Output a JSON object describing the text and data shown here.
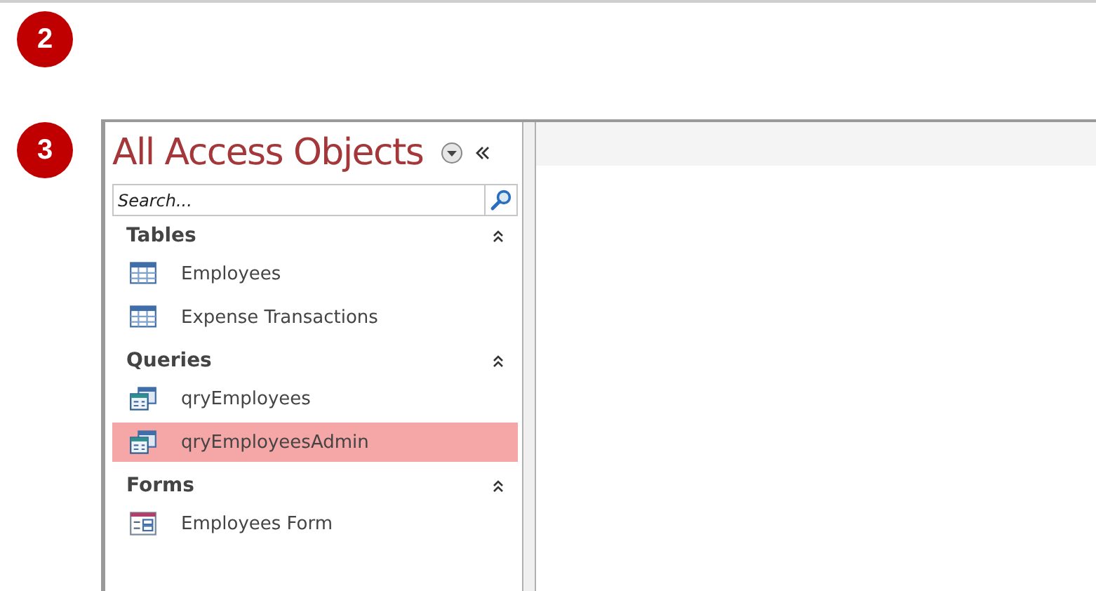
{
  "badges": [
    {
      "label": "2"
    },
    {
      "label": "3"
    }
  ],
  "navigation_pane": {
    "title": "All Access Objects",
    "search": {
      "placeholder": "Search..."
    },
    "groups": [
      {
        "label": "Tables",
        "expanded": true,
        "items": [
          {
            "label": "Employees",
            "kind": "table",
            "selected": false
          },
          {
            "label": "Expense Transactions",
            "kind": "table",
            "selected": false
          }
        ]
      },
      {
        "label": "Queries",
        "expanded": true,
        "items": [
          {
            "label": "qryEmployees",
            "kind": "query",
            "selected": false
          },
          {
            "label": "qryEmployeesAdmin",
            "kind": "query",
            "selected": true
          }
        ]
      },
      {
        "label": "Forms",
        "expanded": true,
        "items": [
          {
            "label": "Employees Form",
            "kind": "form",
            "selected": false
          }
        ]
      }
    ]
  }
}
